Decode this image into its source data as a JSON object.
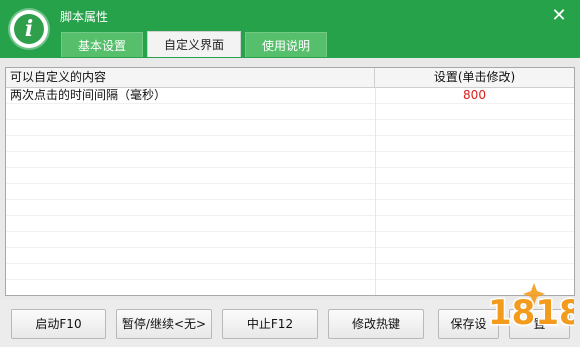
{
  "window": {
    "title": "脚本属性",
    "close_glyph": "✕",
    "icon_letter": "i"
  },
  "tabs": [
    {
      "label": "基本设置",
      "active": false
    },
    {
      "label": "自定义界面",
      "active": true
    },
    {
      "label": "使用说明",
      "active": false
    }
  ],
  "grid": {
    "columns": [
      "可以自定义的内容",
      "设置(单击修改)"
    ],
    "rows": [
      {
        "name": "两次点击的时间间隔（毫秒）",
        "value": "800"
      }
    ]
  },
  "buttons": [
    {
      "label": "启动F10"
    },
    {
      "label": "暂停/继续<无>"
    },
    {
      "label": "中止F12"
    },
    {
      "label": "修改热键"
    },
    {
      "label": "保存设"
    },
    {
      "label": "置"
    }
  ],
  "watermark": {
    "text": "1818"
  },
  "colors": {
    "titlebar": "#25a24a",
    "tab_inactive": "#56bf6c",
    "value_red": "#d81e1e",
    "watermark_orange": "#f39b1c",
    "watermark_stroke": "#ffffff"
  }
}
